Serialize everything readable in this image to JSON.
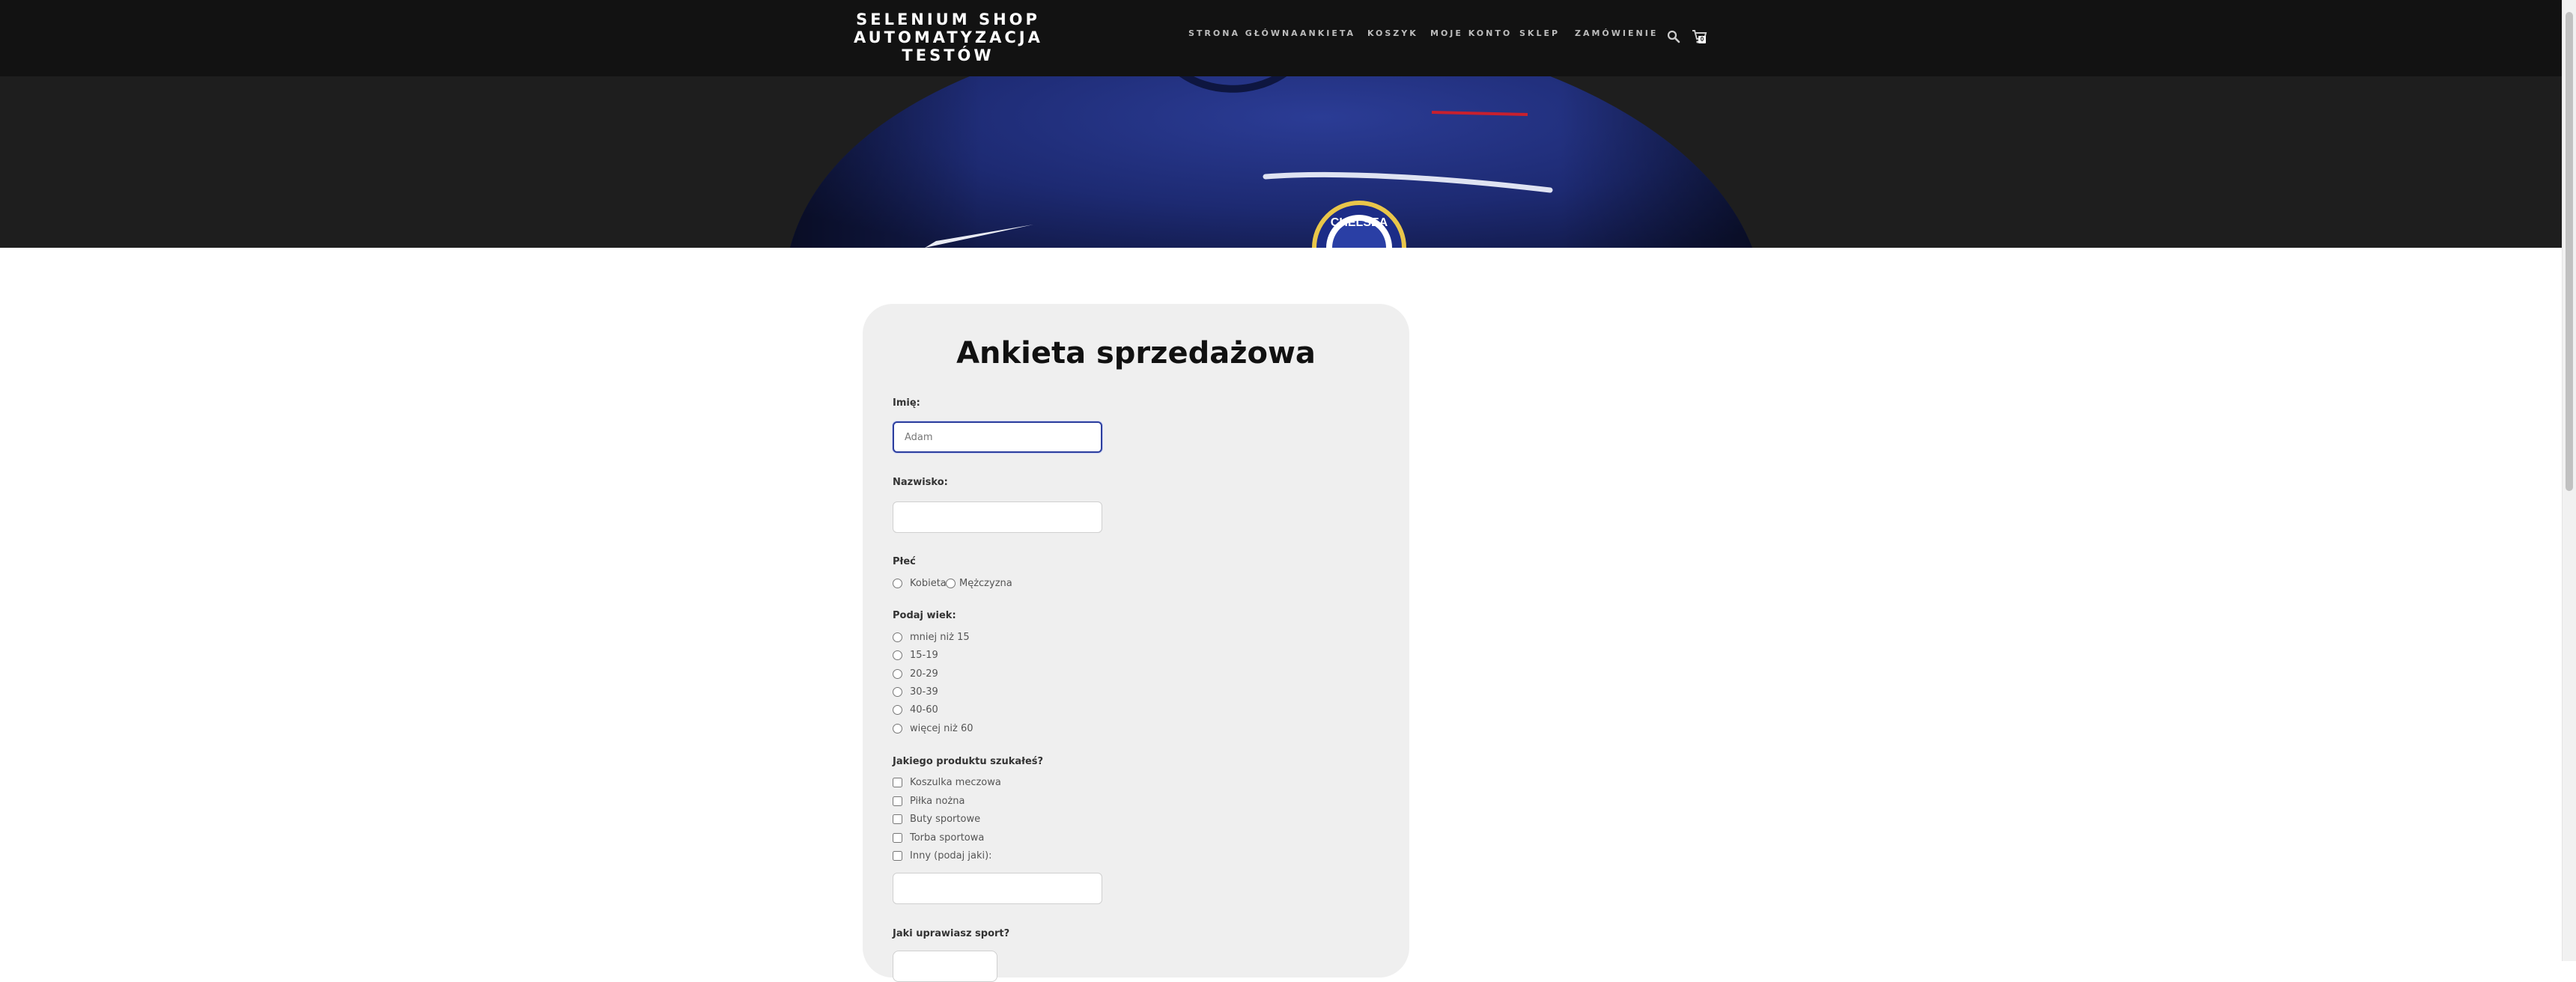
{
  "brand": {
    "line1": "SELENIUM SHOP",
    "line2": "AUTOMATYZACJA",
    "line3": "TESTÓW"
  },
  "nav": {
    "items": [
      {
        "label": "STRONA GŁÓWNA"
      },
      {
        "label": "ANKIETA"
      },
      {
        "label": "KOSZYK"
      },
      {
        "label": "MOJE KONTO"
      },
      {
        "label": "SKLEP"
      },
      {
        "label": "ZAMÓWIENIE"
      }
    ],
    "cart_count": "0",
    "icons": [
      "search-icon",
      "cart-icon"
    ]
  },
  "hero": {
    "image": "navy football jersey with crest",
    "crest_text": "CHELSEA"
  },
  "form": {
    "title": "Ankieta sprzedażowa",
    "first_name": {
      "label": "Imię:",
      "value": "Adam"
    },
    "last_name": {
      "label": "Nazwisko:",
      "value": ""
    },
    "gender": {
      "label": "Płeć",
      "options": [
        "Kobieta",
        "Mężczyzna"
      ]
    },
    "age": {
      "label": "Podaj wiek:",
      "options": [
        "mniej niż 15",
        "15-19",
        "20-29",
        "30-39",
        "40-60",
        "więcej niż 60"
      ]
    },
    "product": {
      "label": "Jakiego produktu szukałeś?",
      "options": [
        "Koszulka meczowa",
        "Piłka nożna",
        "Buty sportowe",
        "Torba sportowa",
        "Inny (podaj jaki):"
      ],
      "other_value": ""
    },
    "sport": {
      "label": "Jaki uprawiasz sport?"
    }
  },
  "colors": {
    "header_bg": "#121212",
    "jersey": "#1b2a7a",
    "focus_border": "#2d3f9e",
    "card_bg": "#efefef"
  }
}
